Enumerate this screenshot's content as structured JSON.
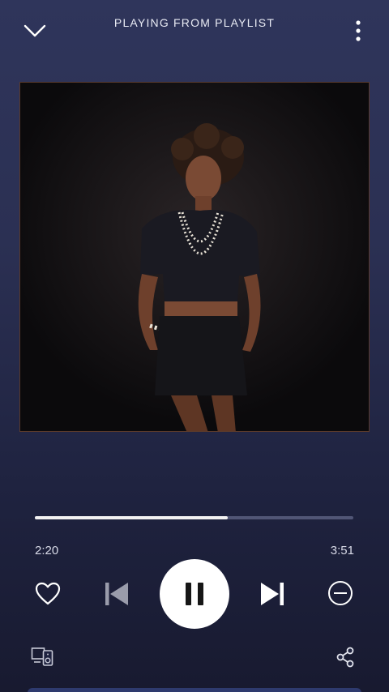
{
  "header": {
    "label": "PLAYING FROM PLAYLIST",
    "collapse_icon": "chevron-down-icon",
    "menu_icon": "more-vertical-icon"
  },
  "artwork": {
    "description": "album-cover-photo"
  },
  "playback": {
    "elapsed": "2:20",
    "duration": "3:51",
    "progress_fraction": 0.606
  },
  "controls": {
    "like_icon": "heart-icon",
    "previous_icon": "skip-previous-icon",
    "pause_icon": "pause-icon",
    "next_icon": "skip-next-icon",
    "hide_icon": "minus-circle-icon"
  },
  "footer": {
    "devices_icon": "connect-devices-icon",
    "share_icon": "share-icon"
  },
  "colors": {
    "background_top": "#2f355b",
    "background_bottom": "#181a30",
    "progress_track": "#515676",
    "progress_fill": "#f2f2f2",
    "accent_white": "#ffffff"
  }
}
